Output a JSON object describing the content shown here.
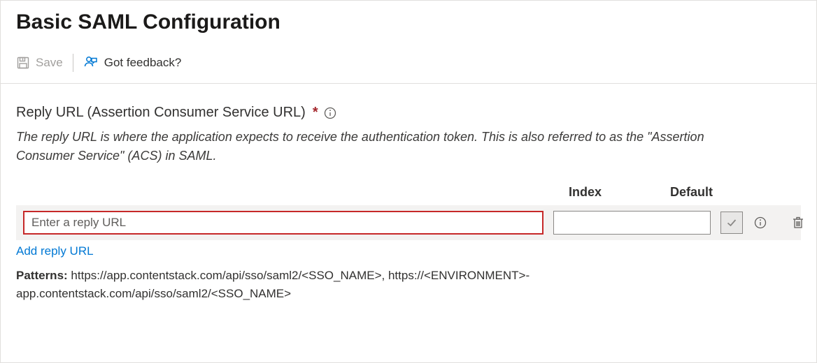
{
  "page": {
    "title": "Basic SAML Configuration"
  },
  "toolbar": {
    "save_label": "Save",
    "feedback_label": "Got feedback?"
  },
  "section": {
    "heading": "Reply URL (Assertion Consumer Service URL)",
    "required_marker": "*",
    "description": "The reply URL is where the application expects to receive the authentication token. This is also referred to as the \"Assertion Consumer Service\" (ACS) in SAML."
  },
  "columns": {
    "index": "Index",
    "default": "Default"
  },
  "row": {
    "url_value": "",
    "url_placeholder": "Enter a reply URL",
    "index_value": ""
  },
  "actions": {
    "add_reply_url": "Add reply URL"
  },
  "patterns": {
    "label": "Patterns:",
    "value": "https://app.contentstack.com/api/sso/saml2/<SSO_NAME>, https://<ENVIRONMENT>-app.contentstack.com/api/sso/saml2/<SSO_NAME>"
  }
}
